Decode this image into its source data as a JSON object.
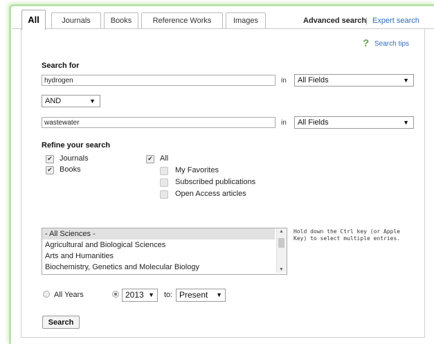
{
  "tabs": [
    {
      "label": "All"
    },
    {
      "label": "Journals"
    },
    {
      "label": "Books"
    },
    {
      "label": "Reference Works"
    },
    {
      "label": "Images"
    }
  ],
  "header": {
    "advanced_search": "Advanced search",
    "separator": "|",
    "expert_search": "Expert search"
  },
  "search_tips": {
    "icon": "?",
    "label": "Search tips"
  },
  "search_for": {
    "label": "Search for",
    "term1": "hydrogen",
    "in1": "in",
    "field1": "All Fields",
    "operator": "AND",
    "term2": "wastewater",
    "in2": "in",
    "field2": "All Fields"
  },
  "refine": {
    "label": "Refine your search",
    "journals": "Journals",
    "books": "Books",
    "all": "All",
    "my_favorites": "My Favorites",
    "subscribed": "Subscribed publications",
    "open_access": "Open Access articles"
  },
  "subjects": {
    "items": [
      "- All Sciences -",
      "Agricultural and Biological Sciences",
      "Arts and Humanities",
      "Biochemistry, Genetics and Molecular Biology"
    ],
    "hint": "Hold down the Ctrl key (or Apple Key) to select multiple entries."
  },
  "years": {
    "all_years": "All Years",
    "from": "2013",
    "to_label": "to:",
    "to": "Present"
  },
  "search_button": "Search",
  "colors": {
    "accent_green": "#6aa84f",
    "link_blue": "#2a6ebb",
    "glow": "#b9e3a8"
  }
}
